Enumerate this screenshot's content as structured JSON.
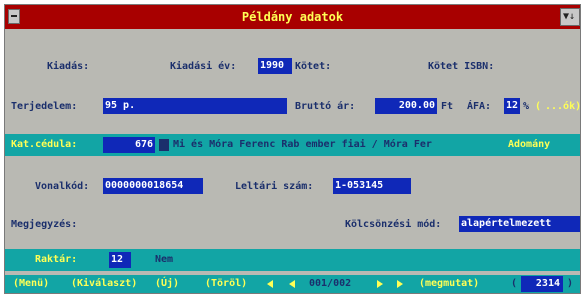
{
  "title": "Példány adatok",
  "fields": {
    "kiadas": {
      "label": "Kiadás:",
      "value": ""
    },
    "kiadasi_ev": {
      "label": "Kiadási év:",
      "value": "1990"
    },
    "kotet": {
      "label": "Kötet:",
      "value": ""
    },
    "kotet_isbn": {
      "label": "Kötet ISBN:",
      "value": ""
    },
    "terjedelem": {
      "label": "Terjedelem:",
      "value": "95 p."
    },
    "brutto_ar": {
      "label": "Bruttó ár:",
      "value": "200.00"
    },
    "ft": "Ft",
    "afa": {
      "label": "ÁFA:",
      "value": "12"
    },
    "afa_percent": "%",
    "afa_k": "(",
    "afa_rest": "...ók)",
    "kat_cedula": {
      "label": "Kat.cédula:",
      "value": "676",
      "text": "Mi és Móra Ferenc  Rab ember fiai / Móra Fer",
      "right": "Adomány"
    },
    "vonalkod": {
      "label": "Vonalkód:",
      "value": "0000000018654"
    },
    "leltari_szam": {
      "label": "Leltári szám:",
      "value": "1-053145"
    },
    "megjegyzes": {
      "label": "Megjegyzés:",
      "value": ""
    },
    "kolcsonzesi_mod": {
      "label": "Kölcsönzési mód:",
      "value": "alapértelmezett"
    },
    "raktar": {
      "label": "Raktár:",
      "value": "12",
      "text": "Nem"
    }
  },
  "bottom_bar": {
    "items": [
      "(Menü)",
      "(Kiválaszt)",
      "(Új)",
      "(Töröl)"
    ],
    "pager": "001/002",
    "memo": "(megmutat)",
    "count_open": "(",
    "count": "2314",
    "count_close": ")"
  },
  "colors": {
    "dialog_bg": "#b9b9b3",
    "title_bg": "#a80000",
    "field_blue": "#0f28b8",
    "teal": "#12a5a5",
    "label": "#1b2f6c",
    "accent_yellow": "#ffff55"
  }
}
